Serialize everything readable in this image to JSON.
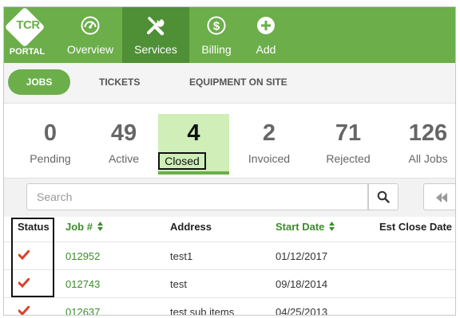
{
  "logo": {
    "text": "TCR",
    "sub": "PORTAL"
  },
  "nav": [
    {
      "label": "Overview",
      "icon": "gauge-icon"
    },
    {
      "label": "Services",
      "icon": "tools-icon"
    },
    {
      "label": "Billing",
      "icon": "dollar-icon"
    },
    {
      "label": "Add",
      "icon": "plus-circle-icon"
    }
  ],
  "subtabs": {
    "jobs": "JOBS",
    "tickets": "TICKETS",
    "equipment": "EQUIPMENT ON SITE"
  },
  "stats": [
    {
      "value": "0",
      "label": "Pending"
    },
    {
      "value": "49",
      "label": "Active"
    },
    {
      "value": "4",
      "label": "Closed"
    },
    {
      "value": "2",
      "label": "Invoiced"
    },
    {
      "value": "71",
      "label": "Rejected"
    },
    {
      "value": "126",
      "label": "All Jobs"
    }
  ],
  "search": {
    "placeholder": "Search"
  },
  "table": {
    "headers": {
      "status": "Status",
      "job": "Job #",
      "address": "Address",
      "start_date": "Start Date",
      "close_date": "Est Close Date"
    },
    "rows": [
      {
        "job": "012952",
        "address": "test1",
        "start_date": "01/12/2017"
      },
      {
        "job": "012743",
        "address": "test",
        "start_date": "09/18/2014"
      },
      {
        "job": "012637",
        "address": "test sub items",
        "start_date": "04/25/2013"
      }
    ]
  },
  "colors": {
    "brand_green": "#6bae4a",
    "active_nav": "#4f8f36",
    "link_green": "#3d8b2b",
    "check_red": "#d9412b"
  }
}
